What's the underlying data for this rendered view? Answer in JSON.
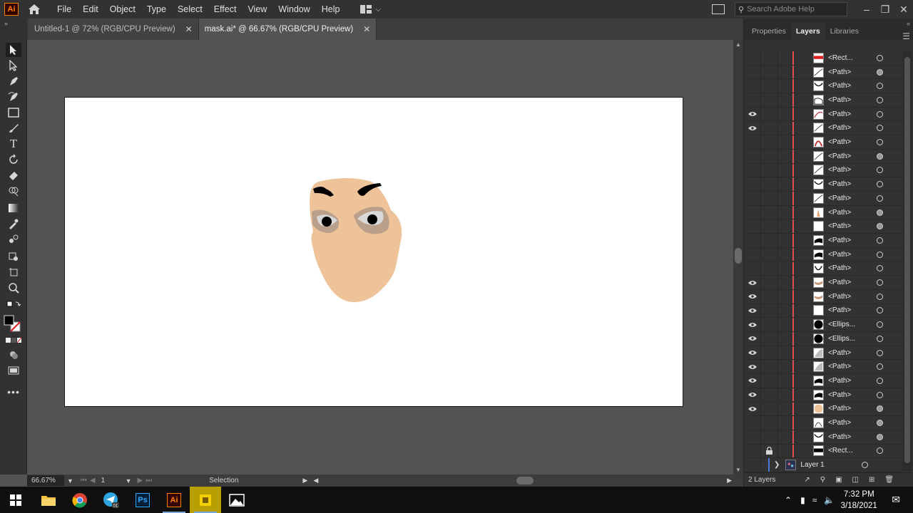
{
  "app": {
    "logo_text": "Ai",
    "menus": [
      "File",
      "Edit",
      "Object",
      "Type",
      "Select",
      "Effect",
      "View",
      "Window",
      "Help"
    ],
    "search_placeholder": "Search Adobe Help"
  },
  "tabs": [
    {
      "label": "Untitled-1 @ 72% (RGB/CPU Preview)",
      "active": false
    },
    {
      "label": "mask.ai* @ 66.67% (RGB/CPU Preview)",
      "active": true
    }
  ],
  "status": {
    "zoom": "66.67%",
    "artboard_number": "1",
    "tool_name": "Selection"
  },
  "panel": {
    "tabs": [
      "Properties",
      "Layers",
      "Libraries"
    ],
    "active_tab": "Layers",
    "layer_count_label": "2 Layers"
  },
  "layers": [
    {
      "name": "<Rect...",
      "visible": false,
      "locked": false,
      "thumb": "rect-red",
      "selected_target": false
    },
    {
      "name": "<Path>",
      "visible": false,
      "locked": false,
      "thumb": "path-line",
      "selected_target": true
    },
    {
      "name": "<Path>",
      "visible": false,
      "locked": false,
      "thumb": "path-curve",
      "selected_target": false
    },
    {
      "name": "<Path>",
      "visible": false,
      "locked": false,
      "thumb": "path-shape",
      "selected_target": false
    },
    {
      "name": "<Path>",
      "visible": true,
      "locked": false,
      "thumb": "path-arc-red",
      "selected_target": false
    },
    {
      "name": "<Path>",
      "visible": true,
      "locked": false,
      "thumb": "path-line",
      "selected_target": false
    },
    {
      "name": "<Path>",
      "visible": false,
      "locked": false,
      "thumb": "path-arch-red",
      "selected_target": false
    },
    {
      "name": "<Path>",
      "visible": false,
      "locked": false,
      "thumb": "path-line",
      "selected_target": true
    },
    {
      "name": "<Path>",
      "visible": false,
      "locked": false,
      "thumb": "path-line",
      "selected_target": false
    },
    {
      "name": "<Path>",
      "visible": false,
      "locked": false,
      "thumb": "path-curve",
      "selected_target": false
    },
    {
      "name": "<Path>",
      "visible": false,
      "locked": false,
      "thumb": "path-line",
      "selected_target": false
    },
    {
      "name": "<Path>",
      "visible": false,
      "locked": false,
      "thumb": "path-skin",
      "selected_target": true
    },
    {
      "name": "<Path>",
      "visible": false,
      "locked": false,
      "thumb": "path-blank",
      "selected_target": true
    },
    {
      "name": "<Path>",
      "visible": false,
      "locked": false,
      "thumb": "path-black",
      "selected_target": false
    },
    {
      "name": "<Path>",
      "visible": false,
      "locked": false,
      "thumb": "path-black",
      "selected_target": false
    },
    {
      "name": "<Path>",
      "visible": false,
      "locked": false,
      "thumb": "path-cup",
      "selected_target": false
    },
    {
      "name": "<Path>",
      "visible": true,
      "locked": false,
      "thumb": "path-tan",
      "selected_target": false
    },
    {
      "name": "<Path>",
      "visible": true,
      "locked": false,
      "thumb": "path-tan",
      "selected_target": false
    },
    {
      "name": "<Path>",
      "visible": true,
      "locked": false,
      "thumb": "path-blank",
      "selected_target": false
    },
    {
      "name": "<Ellips...",
      "visible": true,
      "locked": false,
      "thumb": "ellipse-black",
      "selected_target": false
    },
    {
      "name": "<Ellips...",
      "visible": true,
      "locked": false,
      "thumb": "ellipse-black",
      "selected_target": false
    },
    {
      "name": "<Path>",
      "visible": true,
      "locked": false,
      "thumb": "path-grey",
      "selected_target": false
    },
    {
      "name": "<Path>",
      "visible": true,
      "locked": false,
      "thumb": "path-grey",
      "selected_target": false
    },
    {
      "name": "<Path>",
      "visible": true,
      "locked": false,
      "thumb": "path-black",
      "selected_target": false
    },
    {
      "name": "<Path>",
      "visible": true,
      "locked": false,
      "thumb": "path-black",
      "selected_target": false
    },
    {
      "name": "<Path>",
      "visible": true,
      "locked": false,
      "thumb": "path-skin-full",
      "selected_target": true
    },
    {
      "name": "<Path>",
      "visible": false,
      "locked": false,
      "thumb": "path-arc",
      "selected_target": true
    },
    {
      "name": "<Path>",
      "visible": false,
      "locked": false,
      "thumb": "path-curve",
      "selected_target": true
    },
    {
      "name": "<Rect...",
      "visible": false,
      "locked": true,
      "thumb": "rect-black",
      "selected_target": false
    },
    {
      "name": "Layer 1",
      "visible": false,
      "locked": false,
      "thumb": "layer-thumb",
      "selected_target": false,
      "is_layer": true
    }
  ],
  "taskbar": {
    "apps": [
      "file-explorer",
      "chrome",
      "telegram",
      "photoshop",
      "illustrator",
      "file-manager-app",
      "photos"
    ],
    "time": "7:32 PM",
    "date": "3/18/2021"
  },
  "colors": {
    "skin": "#eec39a",
    "eye_shadow": "#b09a88",
    "eye_white": "#d8d8d8",
    "layer_color": "#e05050"
  }
}
